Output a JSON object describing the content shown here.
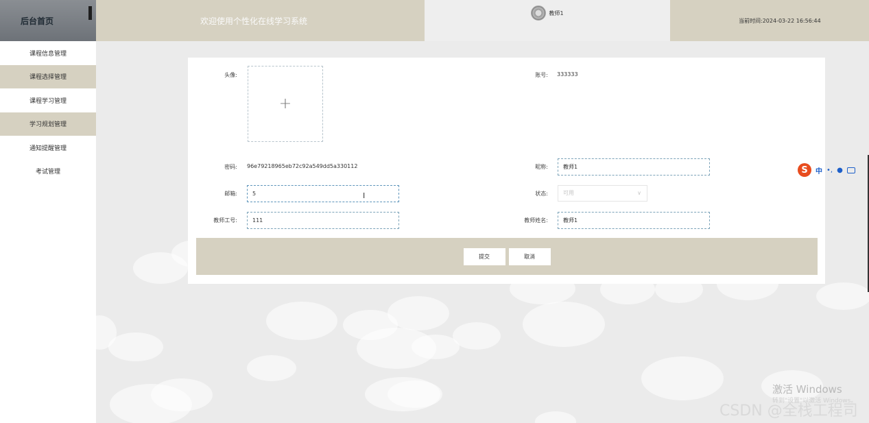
{
  "header": {
    "brand": "后台首页",
    "welcome": "欢迎使用个性化在线学习系统",
    "user_name": "教师1",
    "current_time_label": "当前时间:",
    "current_time": "2024-03-22 16:56:44"
  },
  "sidebar": {
    "items": [
      {
        "label": "课程信息管理"
      },
      {
        "label": "课程选择管理"
      },
      {
        "label": "课程学习管理"
      },
      {
        "label": "学习规划管理"
      },
      {
        "label": "通知提醒管理"
      },
      {
        "label": "考试管理"
      }
    ]
  },
  "form": {
    "avatar_label": "头像:",
    "account_label": "账号:",
    "account_value": "333333",
    "password_label": "密码:",
    "password_value": "96e79218965eb72c92a549dd5a330112",
    "nickname_label": "昵称:",
    "nickname_value": "教师1",
    "email_label": "邮箱:",
    "email_value": "5",
    "status_label": "状态:",
    "status_value": "可用",
    "teacher_id_label": "教师工号:",
    "teacher_id_value": "111",
    "teacher_name_label": "教师姓名:",
    "teacher_name_value": "教师1",
    "submit_label": "提交",
    "cancel_label": "取消"
  },
  "ime": {
    "logo": "S",
    "mode": "中",
    "punct": "•,",
    "mic": "🎤"
  },
  "watermarks": {
    "activate_title": "激活 Windows",
    "activate_sub": "转到\"设置\"以激活 Windows。",
    "csdn": "CSDN @全栈工程司"
  }
}
